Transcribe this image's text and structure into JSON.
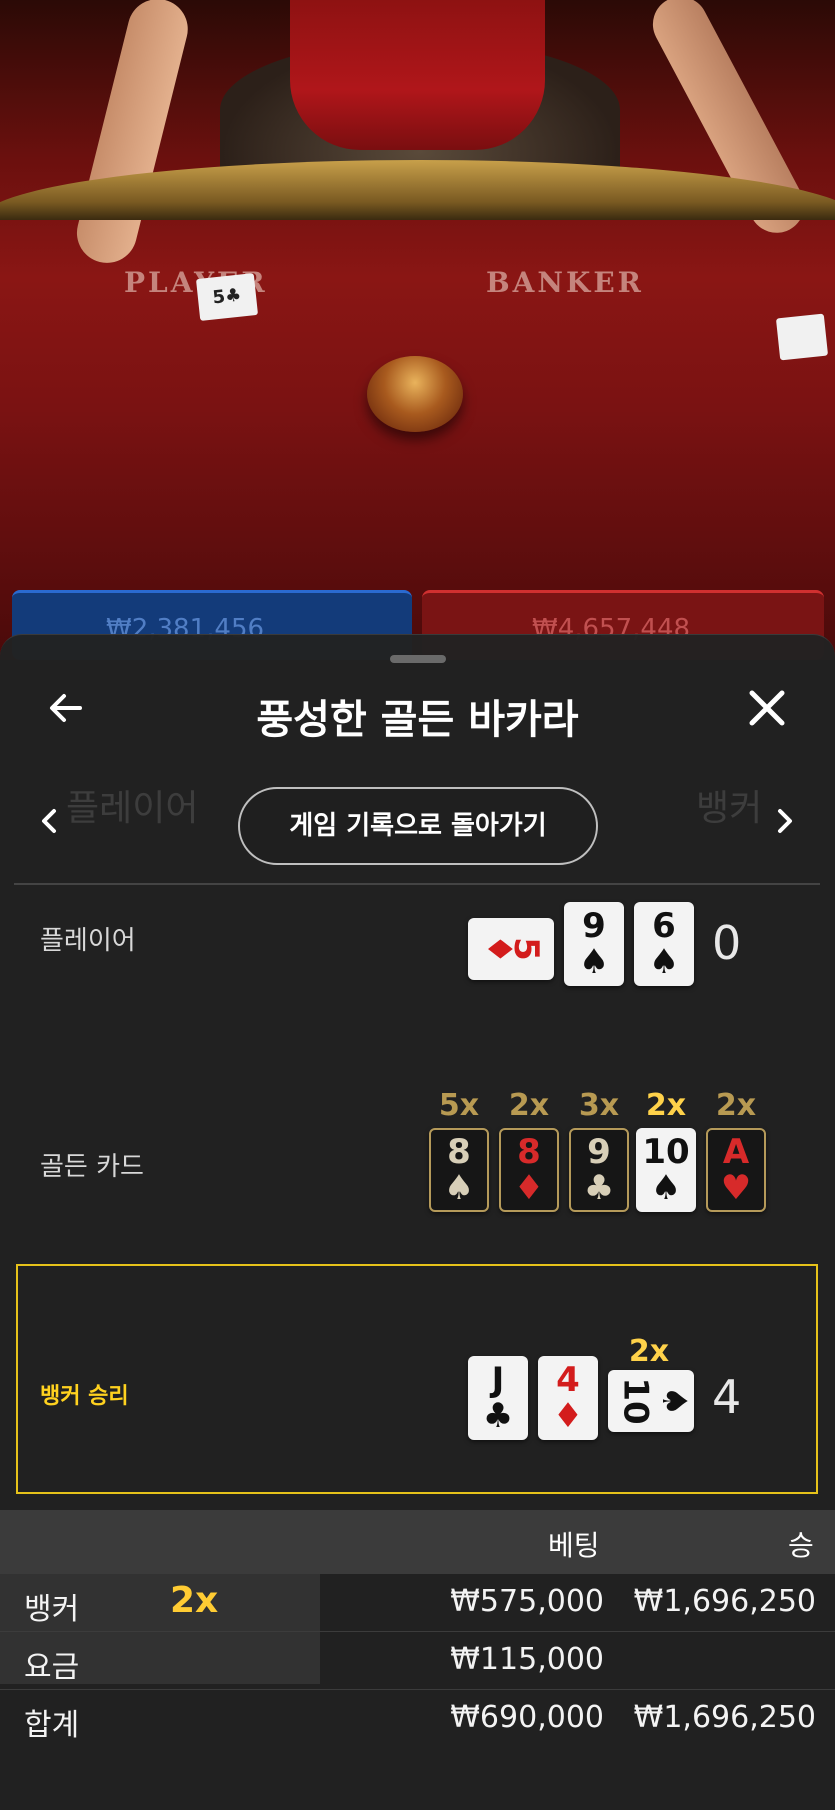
{
  "video": {
    "player_label": "PLAYER",
    "banker_label": "BANKER",
    "player_total": "₩2,381,456",
    "banker_total": "₩4,657,448"
  },
  "sheet": {
    "title": "풍성한 골든 바카라",
    "back_icon": "arrow-left-icon",
    "close_icon": "close-icon",
    "ghost_left": "플레이어",
    "ghost_right": "뱅커",
    "history_button": "게임 기록으로 돌아가기"
  },
  "rows": {
    "player": {
      "label": "플레이어",
      "cards": [
        {
          "rank": "5",
          "suit": "♦",
          "red": true,
          "sideways": true
        },
        {
          "rank": "9",
          "suit": "♠",
          "red": false
        },
        {
          "rank": "6",
          "suit": "♠",
          "red": false
        }
      ],
      "score": "0"
    },
    "golden": {
      "label": "골든 카드",
      "cards": [
        {
          "rank": "8",
          "suit": "♠",
          "red": false,
          "mult": "5x"
        },
        {
          "rank": "8",
          "suit": "♦",
          "red": true,
          "mult": "2x"
        },
        {
          "rank": "9",
          "suit": "♣",
          "red": false,
          "mult": "3x"
        },
        {
          "rank": "10",
          "suit": "♠",
          "red": false,
          "mult": "2x",
          "highlight": true
        },
        {
          "rank": "A",
          "suit": "♥",
          "red": true,
          "mult": "2x"
        }
      ]
    },
    "banker": {
      "label": "뱅커 승리",
      "cards": [
        {
          "rank": "J",
          "suit": "♣",
          "red": false
        },
        {
          "rank": "4",
          "suit": "♦",
          "red": true
        },
        {
          "rank": "10",
          "suit": "♠",
          "red": false,
          "sideways": true,
          "mult": "2x"
        }
      ],
      "score": "4"
    }
  },
  "table": {
    "headers": {
      "bet": "베팅",
      "win": "승"
    },
    "rows": [
      {
        "label": "뱅커",
        "mult": "2x",
        "bet": "₩575,000",
        "win": "₩1,696,250"
      },
      {
        "label": "요금",
        "mult": "",
        "bet": "₩115,000",
        "win": ""
      },
      {
        "label": "합계",
        "mult": "",
        "bet": "₩690,000",
        "win": "₩1,696,250"
      }
    ]
  },
  "colors": {
    "accent_gold": "#ffd21f",
    "banker_red": "#7a1414",
    "player_blue": "#133b7a"
  }
}
